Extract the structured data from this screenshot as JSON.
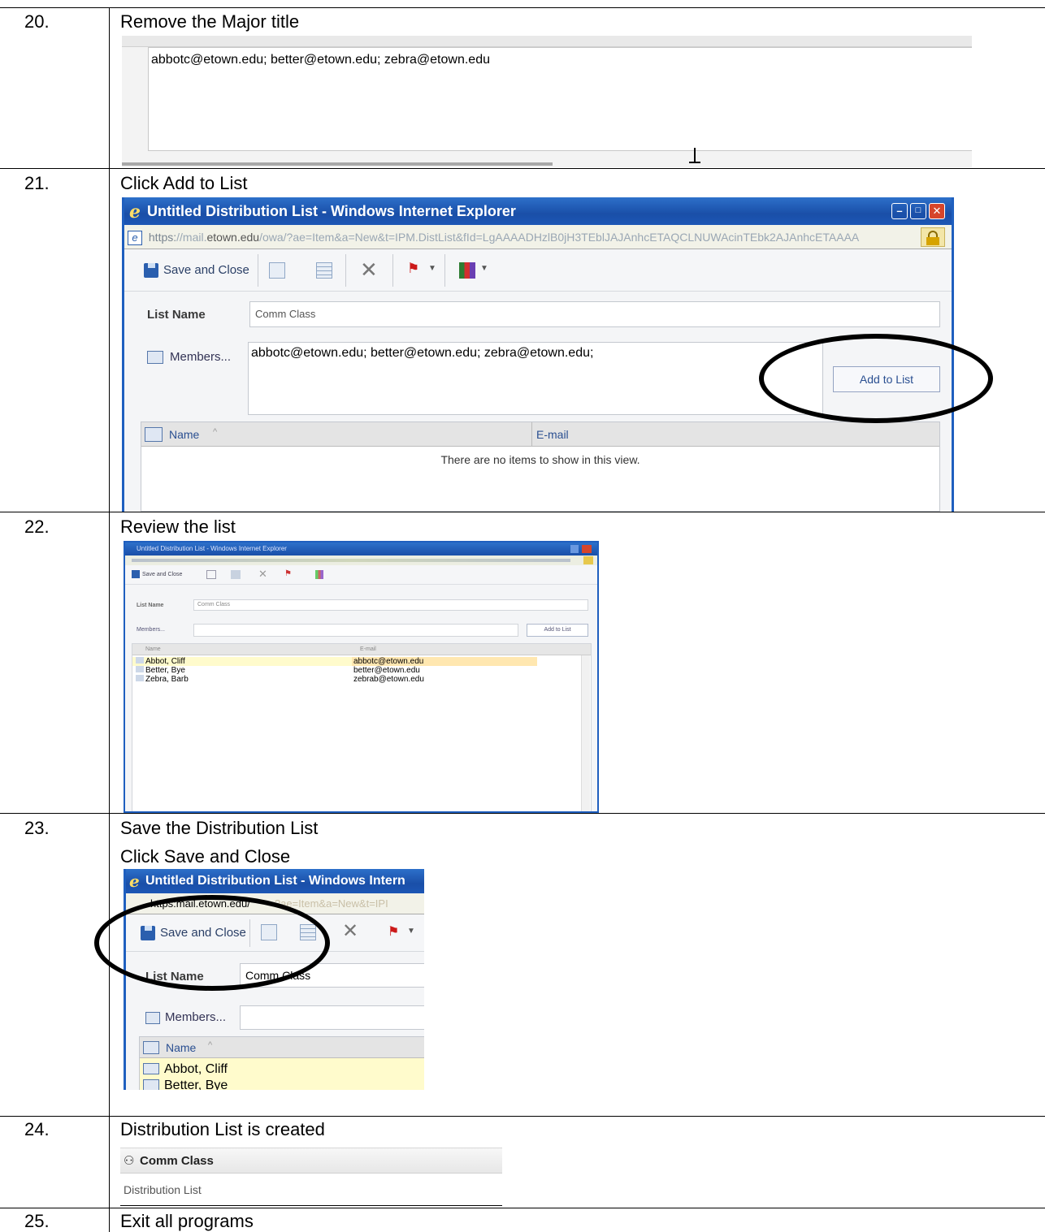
{
  "steps": [
    {
      "number": "20.",
      "text": "Remove the Major title"
    },
    {
      "number": "21.",
      "text": "Click Add to List"
    },
    {
      "number": "22.",
      "text": "Review the list"
    },
    {
      "number": "23.",
      "text": "Save the Distribution List",
      "text2": "Click Save and Close"
    },
    {
      "number": "24.",
      "text": "Distribution List is created"
    },
    {
      "number": "25.",
      "text": "Exit all programs"
    }
  ],
  "step20": {
    "emails": "abbotc@etown.edu; better@etown.edu; zebra@etown.edu"
  },
  "window": {
    "title": "Untitled Distribution List - Windows Internet Explorer",
    "title_cropped": "Untitled Distribution List - Windows Intern",
    "url_scheme": "https:",
    "url_host_prefix": "//mail.",
    "url_host": "etown.edu",
    "url_path": "/owa/?ae=Item&a=New&t=IPM.DistList&fId=LgAAAADHzlB0jH3TEblJAJAnhcETAQCLNUWAcinTEbk2AJAnhcETAAAA",
    "url_path_cropped": "?ae=Item&a=New&t=IPI",
    "url_host_step23": "mail.etown.edu/",
    "save_close": "Save and Close",
    "list_name_label": "List Name",
    "list_name_value": "Comm Class",
    "members_label": "Members...",
    "members_value": "abbotc@etown.edu; better@etown.edu; zebra@etown.edu;",
    "add_to_list": "Add to List",
    "col_name": "Name",
    "col_email": "E-mail",
    "empty_msg": "There are no items to show in this view.",
    "sort_caret": "^"
  },
  "step22": {
    "title": "Untitled Distribution List - Windows Internet Explorer",
    "save_close": "Save and Close",
    "list_name_label": "List Name",
    "list_name_value": "Comm Class",
    "members_label": "Members...",
    "add_to_list": "Add to List",
    "col_name": "Name",
    "col_email": "E-mail",
    "rows": [
      {
        "name": "Abbot, Cliff",
        "email": "abbotc@etown.edu"
      },
      {
        "name": "Better, Bye",
        "email": "better@etown.edu"
      },
      {
        "name": "Zebra, Barb",
        "email": "zebrab@etown.edu"
      }
    ]
  },
  "step23": {
    "rows": [
      "Abbot, Cliff",
      "Better, Bye"
    ]
  },
  "step24": {
    "list_name": "Comm Class",
    "type_label": "Distribution List"
  },
  "colors": {
    "title_bar": "#1a4fa8",
    "highlight_row": "#fffbcc",
    "link_blue": "#2a4f91"
  },
  "icons": [
    "ie-logo-icon",
    "save-icon",
    "print-icon",
    "calendar-icon",
    "delete-icon",
    "flag-icon",
    "categories-icon",
    "lock-icon",
    "address-book-icon",
    "contact-icon",
    "distribution-list-icon"
  ]
}
